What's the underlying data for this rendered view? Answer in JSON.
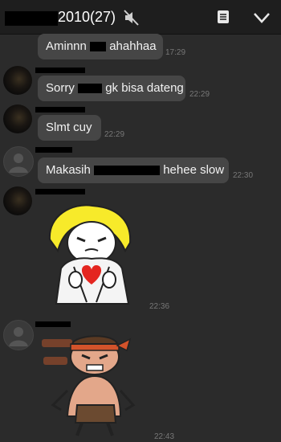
{
  "header": {
    "title": "2010(27)",
    "icons": [
      "mute-icon",
      "notes-icon",
      "chevron-down-icon"
    ]
  },
  "messages": [
    {
      "text_before": "Aminnn",
      "text_after": "ahahhaa",
      "time": "17:29"
    },
    {
      "text_before": "Sorry",
      "text_after": "gk bisa dateng",
      "time": "22:29"
    },
    {
      "text": "Slmt cuy",
      "time": "22:29"
    },
    {
      "text_before": "Makasih",
      "text_after": "hehee slow",
      "time": "22:30"
    },
    {
      "sticker": "heart-sticker",
      "time": "22:36"
    },
    {
      "sticker": "angry-boy-sticker",
      "time": "22:43"
    }
  ],
  "colors": {
    "background": "#2b2b2b",
    "header": "#1e1e1e",
    "bubble": "#464646",
    "time": "#777777"
  }
}
